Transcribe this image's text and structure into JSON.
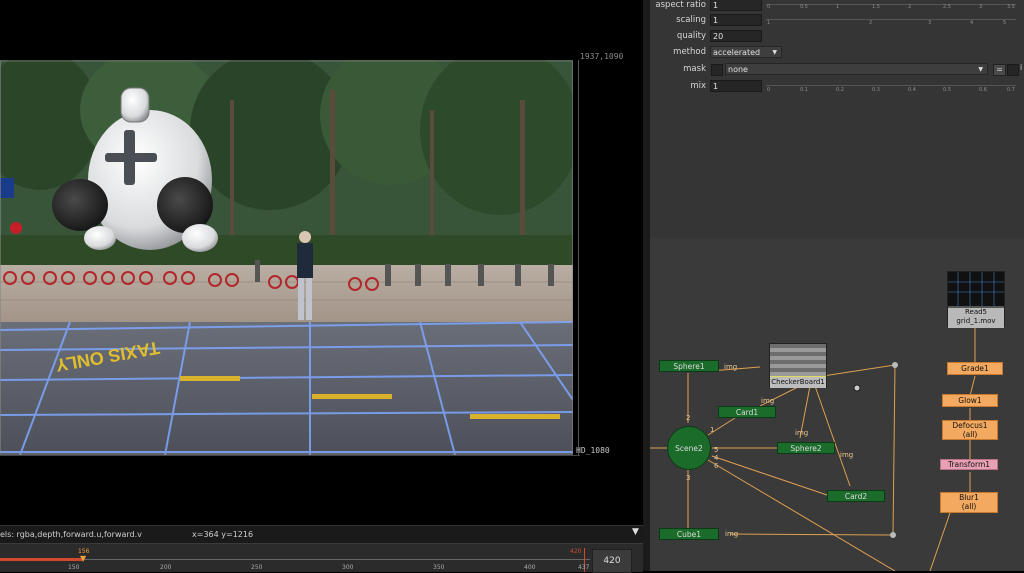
{
  "viewer": {
    "format_corner": "1937,1090",
    "format_name": "HD_1080",
    "photo_text": "TAXIS ONLY",
    "info_channels": "els: rgba,depth,forward.u,forward.v",
    "info_coords": "x=364 y=1216",
    "dropdown_glyph": "▼"
  },
  "timeline": {
    "ticks": [
      "150",
      "200",
      "250",
      "300",
      "350",
      "400",
      "437"
    ],
    "in_marker": "156",
    "out_marker": "420",
    "current_frame": "420"
  },
  "properties": {
    "rows": [
      {
        "label": "aspect ratio",
        "value": "1"
      },
      {
        "label": "scaling",
        "value": "1"
      },
      {
        "label": "quality",
        "value": "20"
      },
      {
        "label": "method",
        "value": "accelerated"
      },
      {
        "label": "mask",
        "value": "none"
      },
      {
        "label": "mix",
        "value": "1"
      }
    ],
    "aspect_ticks": [
      "0",
      "0.5",
      "1",
      "1.5",
      "2",
      "2.5",
      "3",
      "3.5"
    ],
    "scaling_ticks": [
      "1",
      "2",
      "3",
      "4",
      "5"
    ],
    "mix_ticks": [
      "0",
      "0.1",
      "0.2",
      "0.3",
      "0.4",
      "0.5",
      "0.6",
      "0.7"
    ],
    "mask_eq_button": "=",
    "mask_i_label": "i"
  },
  "nodes": {
    "read5": "Read5",
    "read5_file": "grid_1.mov",
    "grade1": "Grade1",
    "glow1": "Glow1",
    "defocus1": "Defocus1",
    "defocus1_sub": "(all)",
    "transform1": "Transform1",
    "blur1": "Blur1",
    "blur1_sub": "(all)",
    "checkerboard1": "CheckerBoard1",
    "sphere1": "Sphere1",
    "sphere2": "Sphere2",
    "card1": "Card1",
    "card2": "Card2",
    "cube1": "Cube1",
    "scene2": "Scene2"
  },
  "edge_labels": {
    "img": "img",
    "n1": "1",
    "n2": "2",
    "n3": "3",
    "n4": "4",
    "n5": "5",
    "n6": "6"
  },
  "colors": {
    "node_orange": "#f3a95f",
    "node_green": "#1b6b2a",
    "edge": "#e0a050",
    "accent_red": "#d0492e"
  }
}
